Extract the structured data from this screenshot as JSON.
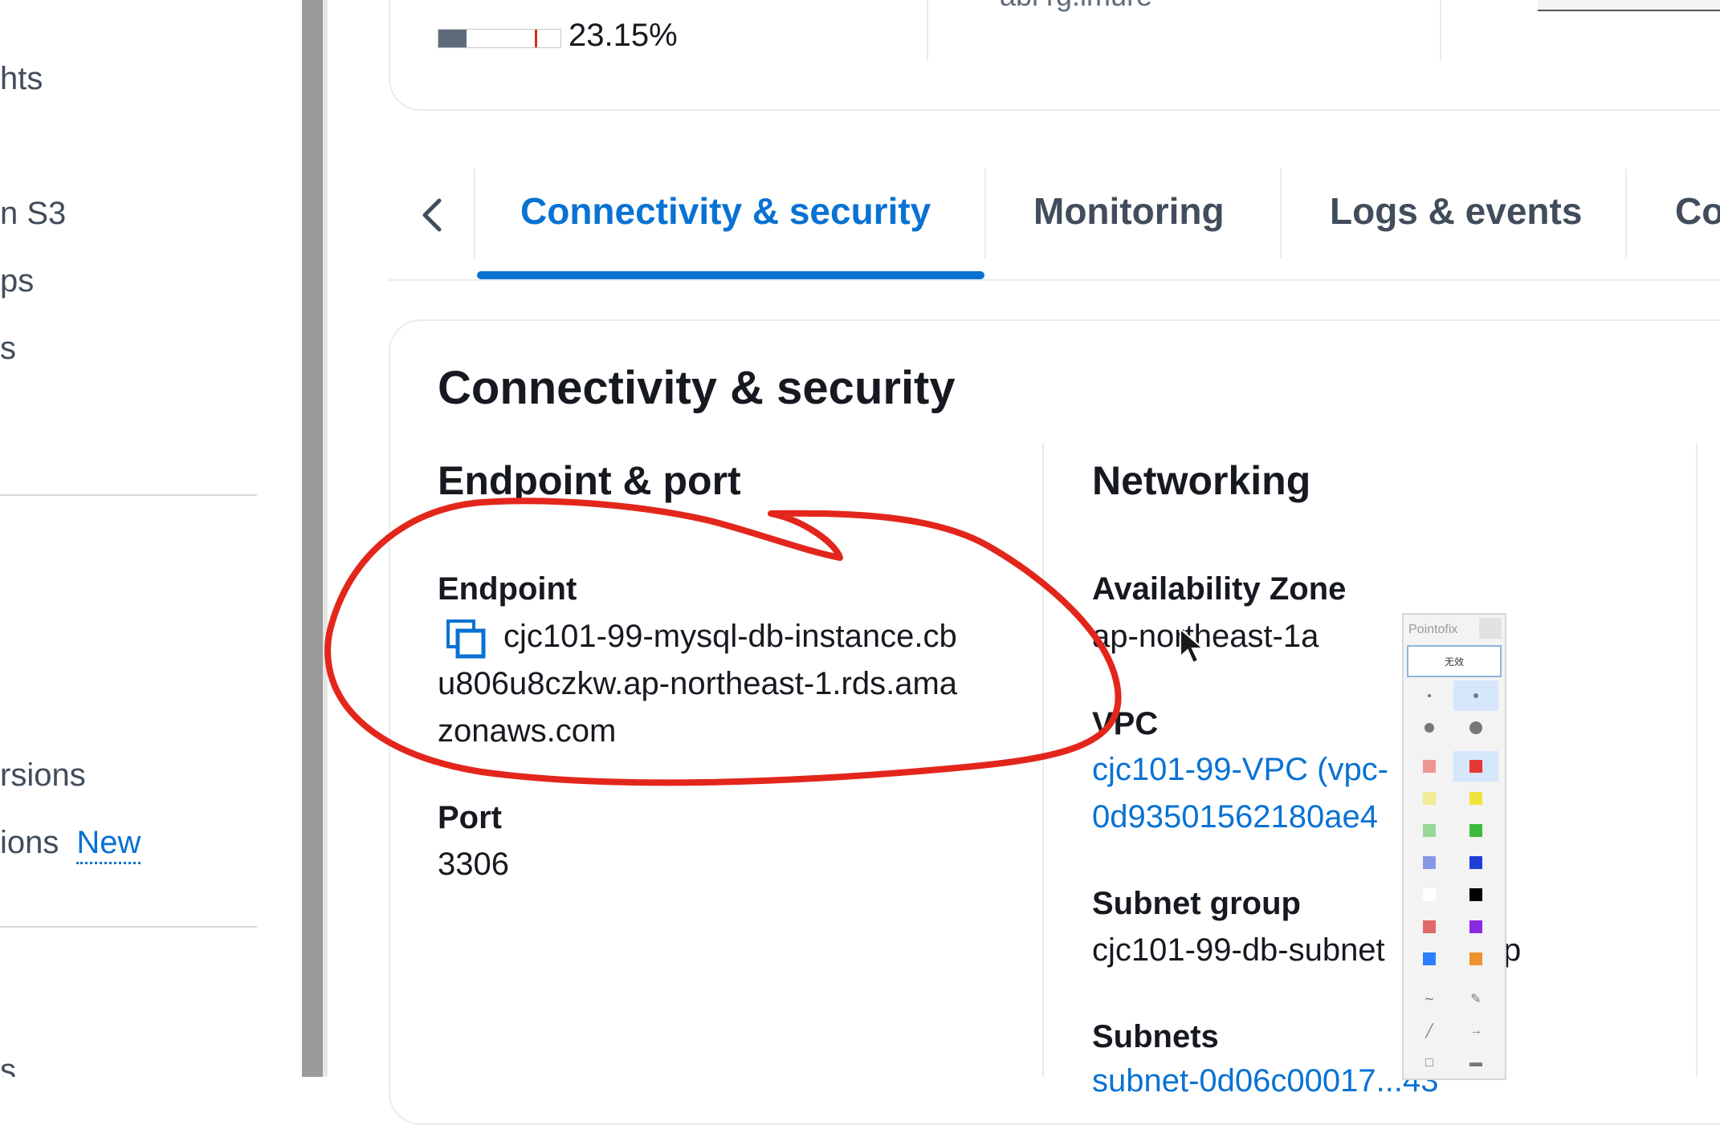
{
  "sidebar": {
    "items": [
      {
        "label": "hts"
      },
      {
        "label": "n S3"
      },
      {
        "label": "ps"
      },
      {
        "label": "s"
      },
      {
        "label": "rsions"
      },
      {
        "label": "ions",
        "badge": "New"
      },
      {
        "label": "s"
      }
    ]
  },
  "summary": {
    "cpu_percent_value": 23.15,
    "cpu_percent_text": "23.15%",
    "snippet_text": "abl rg.imure"
  },
  "tabs": {
    "items": [
      {
        "label": "Connectivity & security",
        "active": true
      },
      {
        "label": "Monitoring",
        "active": false
      },
      {
        "label": "Logs & events",
        "active": false
      },
      {
        "label": "Co",
        "active": false
      }
    ]
  },
  "details": {
    "title": "Connectivity & security",
    "endpoint_section": {
      "title": "Endpoint & port",
      "endpoint_label": "Endpoint",
      "endpoint_value_lines": [
        "cjc101-99-mysql-db-instance.cb",
        "u806u8czkw.ap-northeast-1.rds.ama",
        "zonaws.com"
      ],
      "port_label": "Port",
      "port_value": "3306"
    },
    "networking_section": {
      "title": "Networking",
      "az_label": "Availability Zone",
      "az_value": "ap-northeast-1a",
      "vpc_label": "VPC",
      "vpc_value_lines": [
        "cjc101-99-VPC (vpc-",
        "0d93501562180ae4"
      ],
      "subnet_group_label": "Subnet group",
      "subnet_group_value": "cjc101-99-db-subnet",
      "subnet_group_value_tail": "p",
      "subnets_label": "Subnets",
      "subnets_value": "subnet-0d06c00017...43"
    }
  },
  "palette": {
    "title": "Pointofix",
    "button_label": "无效",
    "colors": [
      "#e53935",
      "#f2e33b",
      "#3dbb3d",
      "#1f3ed8",
      "#000000",
      "#e06a6a",
      "#8a2be2",
      "#2a7fff",
      "#f0922b"
    ]
  },
  "theme": {
    "accent": "#0972d3",
    "annotation": "#e3261c"
  },
  "icons": {
    "tab_prev": "chevron-left-icon",
    "copy": "copy-icon",
    "cursor": "mouse-cursor-icon"
  }
}
